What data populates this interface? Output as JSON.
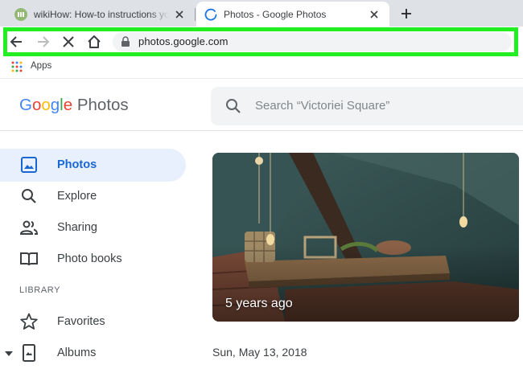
{
  "browser": {
    "tabs": [
      {
        "title": "wikiHow: How-to instructions you can trust",
        "active": false,
        "favicon": "wikihow-icon"
      },
      {
        "title": "Photos - Google Photos",
        "active": true,
        "favicon": "loading-spinner-icon"
      }
    ],
    "url": "photos.google.com",
    "bookmarks": [
      {
        "label": "Apps",
        "icon": "apps-grid-icon"
      }
    ],
    "highlight_color": "#22ee22"
  },
  "app": {
    "logo": {
      "g1": "G",
      "g2": "o",
      "g3": "o",
      "g4": "g",
      "g5": "l",
      "g6": "e",
      "product": "Photos"
    },
    "search_placeholder": "Search “Victoriei Square”",
    "nav": [
      {
        "label": "Photos",
        "icon": "photo-icon",
        "active": true
      },
      {
        "label": "Explore",
        "icon": "search-icon",
        "active": false
      },
      {
        "label": "Sharing",
        "icon": "people-icon",
        "active": false
      },
      {
        "label": "Photo books",
        "icon": "book-icon",
        "active": false
      }
    ],
    "library_heading": "LIBRARY",
    "library": [
      {
        "label": "Favorites",
        "icon": "star-icon"
      },
      {
        "label": "Albums",
        "icon": "album-icon"
      }
    ],
    "memory_caption": "5 years ago",
    "date_heading": "Sun, May 13, 2018",
    "colors": {
      "accent": "#1967d2",
      "active_bg": "#e8f0fe"
    }
  }
}
